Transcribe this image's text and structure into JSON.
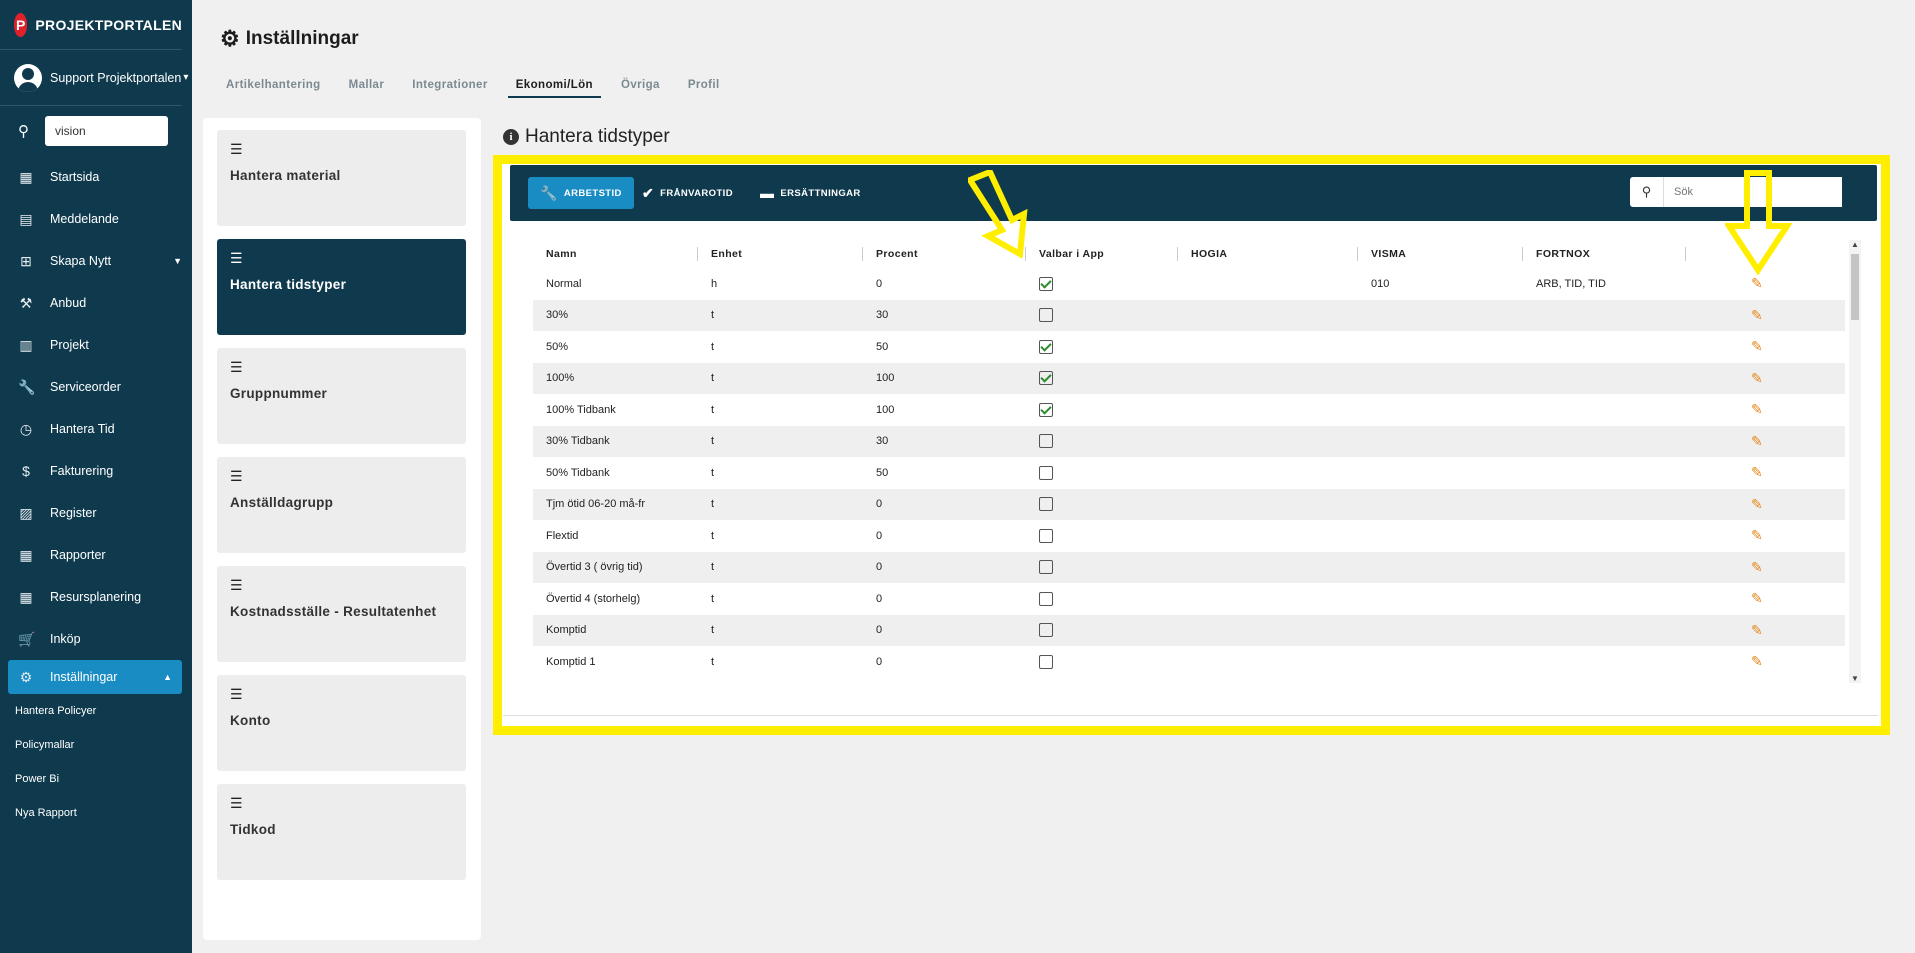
{
  "brand": {
    "name": "PROJEKTPORTALEN",
    "logo_letter": "P"
  },
  "user": {
    "name": "Support Projektportalen"
  },
  "sidebar": {
    "search_value": "vision",
    "items": [
      {
        "label": "Startsida",
        "icon": "dashboard-icon"
      },
      {
        "label": "Meddelande",
        "icon": "message-icon"
      },
      {
        "label": "Skapa Nytt",
        "icon": "add-box-icon"
      },
      {
        "label": "Anbud",
        "icon": "gavel-icon"
      },
      {
        "label": "Projekt",
        "icon": "project-icon"
      },
      {
        "label": "Serviceorder",
        "icon": "wrench-icon"
      },
      {
        "label": "Hantera Tid",
        "icon": "clock-icon"
      },
      {
        "label": "Fakturering",
        "icon": "dollar-icon"
      },
      {
        "label": "Register",
        "icon": "image-icon"
      },
      {
        "label": "Rapporter",
        "icon": "calendar-icon"
      },
      {
        "label": "Resursplanering",
        "icon": "calendar-icon"
      },
      {
        "label": "Inköp",
        "icon": "cart-icon"
      },
      {
        "label": "Inställningar",
        "icon": "gear-icon"
      }
    ],
    "subitems": [
      "Hantera Policyer",
      "Policymallar",
      "Power Bi",
      "Nya Rapport"
    ]
  },
  "header": {
    "title": "Inställningar",
    "tabs": [
      "Artikelhantering",
      "Mallar",
      "Integrationer",
      "Ekonomi/Lön",
      "Övriga",
      "Profil"
    ],
    "active_tab": "Ekonomi/Lön"
  },
  "cards": [
    "Hantera material",
    "Hantera tidstyper",
    "Gruppnummer",
    "Anställdagrupp",
    "Kostnadsställe - Resultatenhet",
    "Konto",
    "Tidkod"
  ],
  "active_card": "Hantera tidstyper",
  "section": {
    "title": "Hantera tidstyper",
    "toolbar": {
      "buttons": [
        "ARBETSTID",
        "FRÅNVAROTID",
        "ERSÄTTNINGAR"
      ],
      "search_placeholder": "Sök"
    }
  },
  "table": {
    "columns": [
      "Namn",
      "Enhet",
      "Procent",
      "Valbar i App",
      "HOGIA",
      "VISMA",
      "FORTNOX",
      ""
    ],
    "rows": [
      {
        "name": "Normal",
        "unit": "h",
        "percent": "0",
        "valbar": true,
        "hogia": "",
        "visma": "010",
        "fortnox": "ARB, TID, TID"
      },
      {
        "name": "30%",
        "unit": "t",
        "percent": "30",
        "valbar": false,
        "hogia": "",
        "visma": "",
        "fortnox": ""
      },
      {
        "name": "50%",
        "unit": "t",
        "percent": "50",
        "valbar": true,
        "hogia": "",
        "visma": "",
        "fortnox": ""
      },
      {
        "name": "100%",
        "unit": "t",
        "percent": "100",
        "valbar": true,
        "hogia": "",
        "visma": "",
        "fortnox": ""
      },
      {
        "name": "100% Tidbank",
        "unit": "t",
        "percent": "100",
        "valbar": true,
        "hogia": "",
        "visma": "",
        "fortnox": ""
      },
      {
        "name": "30% Tidbank",
        "unit": "t",
        "percent": "30",
        "valbar": false,
        "hogia": "",
        "visma": "",
        "fortnox": ""
      },
      {
        "name": "50% Tidbank",
        "unit": "t",
        "percent": "50",
        "valbar": false,
        "hogia": "",
        "visma": "",
        "fortnox": ""
      },
      {
        "name": "Tjm ötid 06-20 må-fr",
        "unit": "t",
        "percent": "0",
        "valbar": false,
        "hogia": "",
        "visma": "",
        "fortnox": ""
      },
      {
        "name": "Flextid",
        "unit": "t",
        "percent": "0",
        "valbar": false,
        "hogia": "",
        "visma": "",
        "fortnox": ""
      },
      {
        "name": "Övertid 3 ( övrig tid)",
        "unit": "t",
        "percent": "0",
        "valbar": false,
        "hogia": "",
        "visma": "",
        "fortnox": ""
      },
      {
        "name": "Övertid 4 (storhelg)",
        "unit": "t",
        "percent": "0",
        "valbar": false,
        "hogia": "",
        "visma": "",
        "fortnox": ""
      },
      {
        "name": "Komptid",
        "unit": "t",
        "percent": "0",
        "valbar": false,
        "hogia": "",
        "visma": "",
        "fortnox": ""
      },
      {
        "name": "Komptid 1",
        "unit": "t",
        "percent": "0",
        "valbar": false,
        "hogia": "",
        "visma": "",
        "fortnox": ""
      }
    ]
  },
  "colors": {
    "sidebar_bg": "#0f3a4e",
    "accent": "#1a8cc4",
    "highlight": "#ffee00",
    "edit_icon": "#e8871a",
    "check": "#2e8b2e"
  }
}
